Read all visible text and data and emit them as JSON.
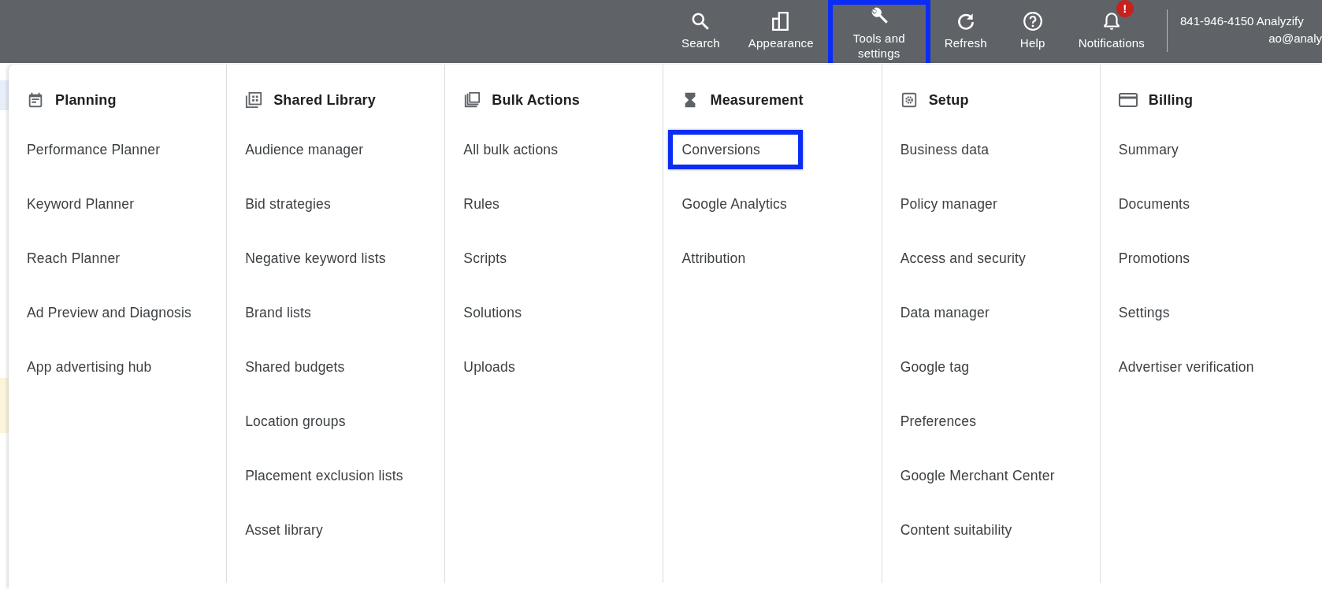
{
  "top_bar": {
    "actions": [
      {
        "label": "Search",
        "kind": "search",
        "highlighted": false
      },
      {
        "label": "Appearance",
        "kind": "appearance",
        "highlighted": false
      },
      {
        "label": "Tools and settings",
        "kind": "wrench",
        "highlighted": true
      },
      {
        "label": "Refresh",
        "kind": "refresh",
        "highlighted": false
      },
      {
        "label": "Help",
        "kind": "help",
        "highlighted": false
      },
      {
        "label": "Notifications",
        "kind": "bell",
        "highlighted": false,
        "badge": "!"
      }
    ],
    "account": {
      "line_1": "841-946-4150 Analyzify",
      "line_2": "ao@analy"
    }
  },
  "menu": {
    "columns": [
      {
        "title": "Planning",
        "kind": "calendar",
        "items": [
          {
            "label": "Performance Planner",
            "highlighted": false
          },
          {
            "label": "Keyword Planner",
            "highlighted": false
          },
          {
            "label": "Reach Planner",
            "highlighted": false
          },
          {
            "label": "Ad Preview and Diagnosis",
            "highlighted": false
          },
          {
            "label": "App advertising hub",
            "highlighted": false
          }
        ]
      },
      {
        "title": "Shared Library",
        "kind": "library",
        "items": [
          {
            "label": "Audience manager",
            "highlighted": false
          },
          {
            "label": "Bid strategies",
            "highlighted": false
          },
          {
            "label": "Negative keyword lists",
            "highlighted": false
          },
          {
            "label": "Brand lists",
            "highlighted": false
          },
          {
            "label": "Shared budgets",
            "highlighted": false
          },
          {
            "label": "Location groups",
            "highlighted": false
          },
          {
            "label": "Placement exclusion lists",
            "highlighted": false
          },
          {
            "label": "Asset library",
            "highlighted": false
          }
        ]
      },
      {
        "title": "Bulk Actions",
        "kind": "copies",
        "items": [
          {
            "label": "All bulk actions",
            "highlighted": false
          },
          {
            "label": "Rules",
            "highlighted": false
          },
          {
            "label": "Scripts",
            "highlighted": false
          },
          {
            "label": "Solutions",
            "highlighted": false
          },
          {
            "label": "Uploads",
            "highlighted": false
          }
        ]
      },
      {
        "title": "Measurement",
        "kind": "hourglass",
        "items": [
          {
            "label": "Conversions",
            "highlighted": true
          },
          {
            "label": "Google Analytics",
            "highlighted": false
          },
          {
            "label": "Attribution",
            "highlighted": false
          }
        ]
      },
      {
        "title": "Setup",
        "kind": "gear",
        "items": [
          {
            "label": "Business data",
            "highlighted": false
          },
          {
            "label": "Policy manager",
            "highlighted": false
          },
          {
            "label": "Access and security",
            "highlighted": false
          },
          {
            "label": "Data manager",
            "highlighted": false
          },
          {
            "label": "Google tag",
            "highlighted": false
          },
          {
            "label": "Preferences",
            "highlighted": false
          },
          {
            "label": "Google Merchant Center",
            "highlighted": false
          },
          {
            "label": "Content suitability",
            "highlighted": false
          }
        ]
      },
      {
        "title": "Billing",
        "kind": "card",
        "items": [
          {
            "label": "Summary",
            "highlighted": false
          },
          {
            "label": "Documents",
            "highlighted": false
          },
          {
            "label": "Promotions",
            "highlighted": false
          },
          {
            "label": "Settings",
            "highlighted": false
          },
          {
            "label": "Advertiser verification",
            "highlighted": false
          }
        ]
      }
    ]
  }
}
